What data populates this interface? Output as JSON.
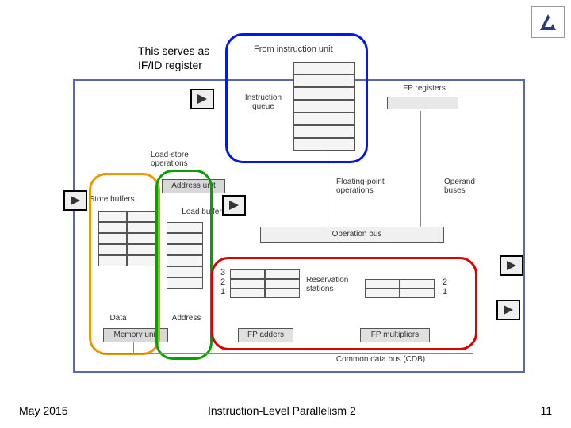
{
  "annotation": {
    "line1": "This serves as",
    "line2": "IF/ID register"
  },
  "labels": {
    "from_instr_unit": "From instruction unit",
    "instruction_queue": "Instruction queue",
    "fp_registers": "FP registers",
    "load_store_ops": "Load-store operations",
    "address_unit": "Address unit",
    "store_buffers": "Store buffers",
    "load_buffers": "Load buffers",
    "floating_point_ops": "Floating-point operations",
    "operand_buses": "Operand buses",
    "operation_bus": "Operation bus",
    "reservation_stations": "Reservation stations",
    "fp_adders": "FP adders",
    "fp_multipliers": "FP multipliers",
    "memory_unit": "Memory unit",
    "data": "Data",
    "address": "Address",
    "cdb": "Common data bus (CDB)"
  },
  "numbers": {
    "n1": "1",
    "n2": "2",
    "n3": "3"
  },
  "footer": {
    "date": "May 2015",
    "title": "Instruction-Level Parallelism 2",
    "page": "11"
  }
}
